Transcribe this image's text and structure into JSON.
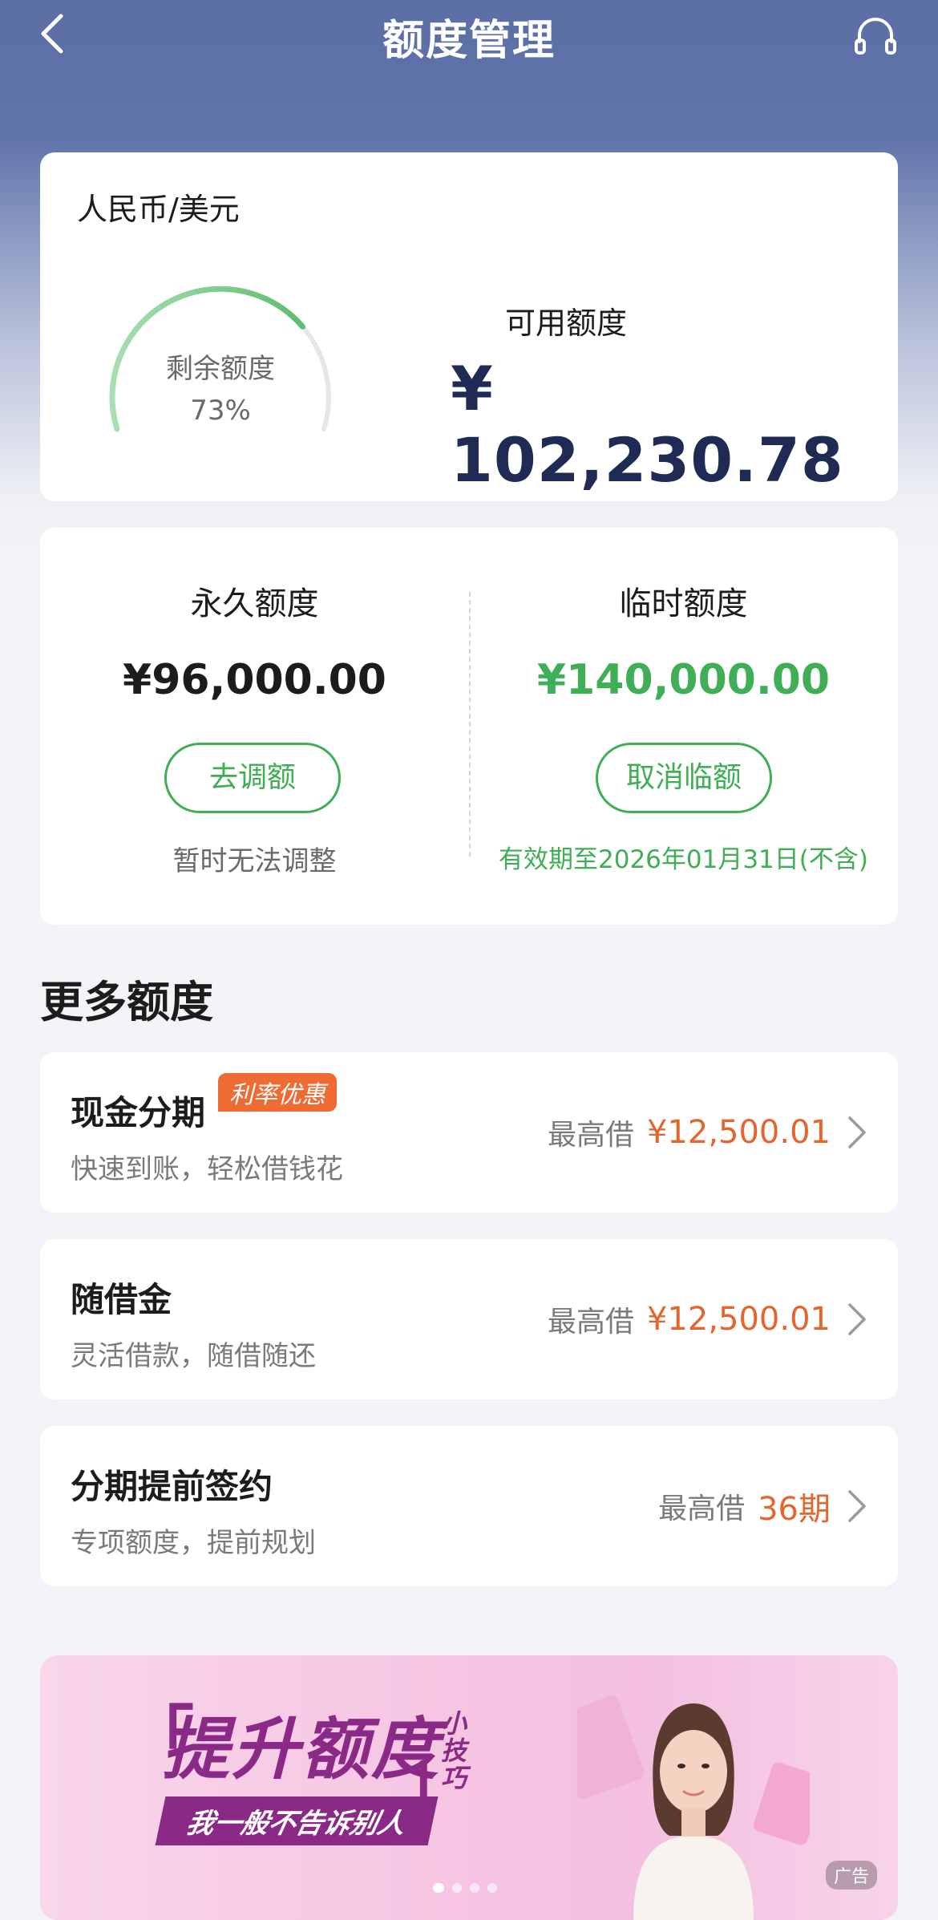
{
  "header": {
    "title": "额度管理",
    "back_icon": "chevron-left-icon",
    "service_icon": "headset-icon"
  },
  "quota": {
    "currency_label": "人民币/美元",
    "gauge_label": "剩余额度",
    "gauge_percent": "73%",
    "gauge_fraction": 0.73,
    "available_label": "可用额度",
    "available_amount": "¥ 102,230.78"
  },
  "limits": {
    "permanent": {
      "title": "永久额度",
      "amount": "¥96,000.00",
      "button": "去调额",
      "note": "暂时无法调整"
    },
    "temporary": {
      "title": "临时额度",
      "amount": "¥140,000.00",
      "button": "取消临额",
      "note": "有效期至2026年01月31日(不含)"
    }
  },
  "more": {
    "title": "更多额度",
    "items": [
      {
        "title": "现金分期",
        "tag": "利率优惠",
        "subtitle": "快速到账，轻松借钱花",
        "max_label": "最高借",
        "value": "¥12,500.01"
      },
      {
        "title": "随借金",
        "subtitle": "灵活借款，随借随还",
        "max_label": "最高借",
        "value": "¥12,500.01"
      },
      {
        "title": "分期提前签约",
        "subtitle": "专项额度，提前规划",
        "max_label": "最高借",
        "value": "36期"
      }
    ]
  },
  "banner": {
    "main_text": "提升额度",
    "tip_text": "小技巧",
    "sub_text": "我一般不告诉别人",
    "ad_label": "广告",
    "dots": 4,
    "active_dot": 0
  },
  "colors": {
    "header_bg": "#5b6fa6",
    "green": "#3fae55",
    "orange": "#e2662e",
    "navy": "#1f2a55",
    "banner_purple": "#8a2a86"
  }
}
